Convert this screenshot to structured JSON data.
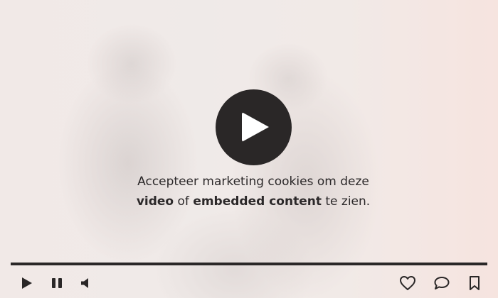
{
  "overlay": {
    "message_line1": "Accepteer marketing cookies om deze",
    "message_bold1": "video",
    "message_mid": " of ",
    "message_bold2": "embedded content",
    "message_end": " te zien."
  },
  "colors": {
    "accent_dark": "#2a2727",
    "icon_white": "#ffffff"
  },
  "controls": {
    "left": [
      "play-icon",
      "pause-icon",
      "volume-icon"
    ],
    "right": [
      "heart-icon",
      "comment-icon",
      "bookmark-icon"
    ]
  }
}
